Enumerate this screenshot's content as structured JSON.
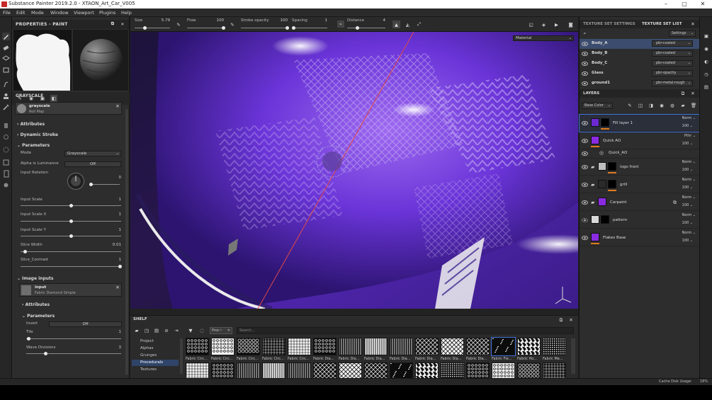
{
  "window": {
    "title": "Substance Painter 2019.2.0 - XTAON_Art_Car_V005"
  },
  "menu": [
    "File",
    "Edit",
    "Mode",
    "Window",
    "Viewport",
    "Plugins",
    "Help"
  ],
  "toolbar_top": {
    "size": {
      "label": "Size",
      "value": "5.79"
    },
    "flow": {
      "label": "Flow",
      "value": "100"
    },
    "stroke_opacity": {
      "label": "Stroke opacity",
      "value": "100"
    },
    "spacing": {
      "label": "Spacing",
      "value": "1"
    },
    "distance": {
      "label": "Distance",
      "value": "4"
    }
  },
  "viewport": {
    "display_channel": "Material"
  },
  "properties": {
    "title": "PROPERTIES - PAINT",
    "section": "GRAYSCALE",
    "resource": {
      "name": "grayscale",
      "type": "Roll Map"
    },
    "attributes_label": "Attributes",
    "dynamic_stroke_label": "Dynamic Stroke",
    "parameters_label": "Parameters",
    "mode": {
      "label": "Mode",
      "value": "Grayscale"
    },
    "alpha_luminance": {
      "label": "Alpha is Luminance",
      "value": "Off"
    },
    "input_rotation": {
      "label": "Input Rotation",
      "value": "0"
    },
    "input_scale": {
      "label": "Input Scale",
      "value": "1"
    },
    "input_scale_x": {
      "label": "Input Scale X",
      "value": "1"
    },
    "input_scale_y": {
      "label": "Input Scale Y",
      "value": "1"
    },
    "slice_width": {
      "label": "Slice Width",
      "value": "0.01"
    },
    "slice_contrast": {
      "label": "Slice_Contrast",
      "value": "1"
    },
    "image_inputs_label": "Image inputs",
    "input_resource": {
      "name": "input",
      "type": "Fabric Diamond Simple"
    },
    "sub_attributes_label": "Attributes",
    "sub_parameters_label": "Parameters",
    "invert": {
      "label": "Invert",
      "value": "Off"
    },
    "tile": {
      "label": "Tile",
      "value": "1"
    },
    "wave_divisions": {
      "label": "Wave Divisions",
      "value": "3"
    }
  },
  "texture_sets": {
    "tab_settings": "TEXTURE SET SETTINGS",
    "tab_list": "TEXTURE SET LIST",
    "settings_button": "Settings",
    "rows": [
      {
        "name": "Body_A",
        "shader": "pbr-coated"
      },
      {
        "name": "Body_B",
        "shader": "pbr-coated"
      },
      {
        "name": "Body_C",
        "shader": "pbr-coated"
      },
      {
        "name": "Glass",
        "shader": "pbr-opacity"
      },
      {
        "name": "ground1",
        "shader": "pbr-metal-rough"
      }
    ]
  },
  "layers": {
    "title": "LAYERS",
    "channel": "Base Color",
    "rows": [
      {
        "name": "Fill layer 1",
        "blend": "Norm",
        "opacity": "100"
      },
      {
        "name": "Quick AO",
        "blend": "Pthr",
        "opacity": "100"
      },
      {
        "name": "Quick_AO",
        "blend": "",
        "opacity": ""
      },
      {
        "name": "logo front",
        "blend": "Norm",
        "opacity": "100"
      },
      {
        "name": "grill",
        "blend": "Norm",
        "opacity": "100"
      },
      {
        "name": "Carpaint",
        "blend": "Norm",
        "opacity": "100"
      },
      {
        "name": "pattern",
        "blend": "Norm",
        "opacity": "100"
      },
      {
        "name": "Flakes Base",
        "blend": "Norm",
        "opacity": "100"
      }
    ]
  },
  "shelf": {
    "title": "SHELF",
    "filter_tag": "Proc~",
    "search_placeholder": "Search...",
    "categories": [
      "Project",
      "Alphas",
      "Grunges",
      "Procedurals",
      "Textures"
    ],
    "selected_category": "Procedurals",
    "labels": [
      "Fabric Circ...",
      "Fabric Circ...",
      "Fabric Circ...",
      "Fabric Circ...",
      "Fabric Circ...",
      "Fabric Dia...",
      "Fabric Dia...",
      "Fabric Dia...",
      "Fabric Dia...",
      "Fabric Dia...",
      "Fabric Dia...",
      "Fabric Dia...",
      "Fabric Fle...",
      "Fabric Ho...",
      "Fabric Me..."
    ]
  },
  "status": {
    "cache": "Cache Disk Usage:",
    "percent": "18%"
  },
  "colors": {
    "accent": "#3d6fd8",
    "purple": "#6a2ad0",
    "orange": "#e07b1d",
    "selection": "#3b4c6e"
  }
}
